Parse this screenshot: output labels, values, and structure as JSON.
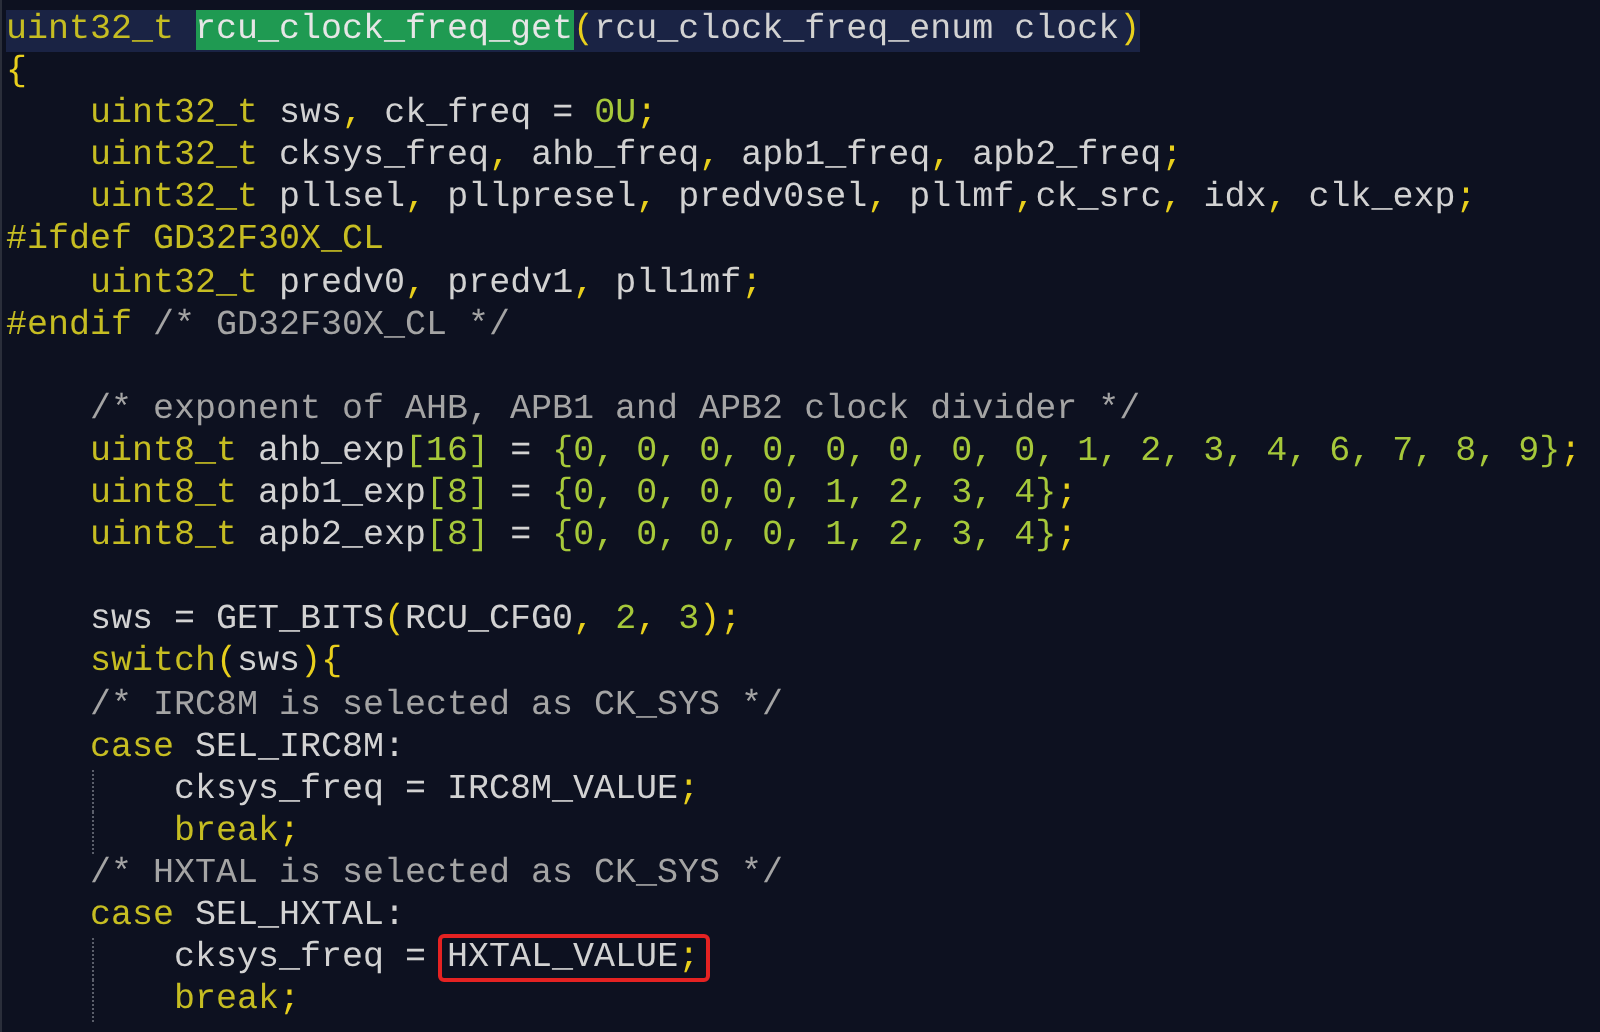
{
  "editor": {
    "lines": [
      {
        "current": true,
        "guide": false,
        "tokens": [
          {
            "kind": "type",
            "text": "uint32_t "
          },
          {
            "kind": "hl",
            "text": "rcu_clock_freq_get"
          },
          {
            "kind": "punct",
            "text": "("
          },
          {
            "kind": "plain",
            "text": "rcu_clock_freq_enum clock"
          },
          {
            "kind": "punct",
            "text": ")"
          }
        ]
      },
      {
        "current": false,
        "guide": false,
        "tokens": [
          {
            "kind": "punct",
            "text": "{"
          }
        ]
      },
      {
        "current": false,
        "guide": false,
        "tokens": [
          {
            "kind": "type",
            "text": "    uint32_t"
          },
          {
            "kind": "plain",
            "text": " sws"
          },
          {
            "kind": "punct",
            "text": ","
          },
          {
            "kind": "plain",
            "text": " ck_freq = "
          },
          {
            "kind": "num",
            "text": "0U"
          },
          {
            "kind": "punct",
            "text": ";"
          }
        ]
      },
      {
        "current": false,
        "guide": false,
        "tokens": [
          {
            "kind": "type",
            "text": "    uint32_t"
          },
          {
            "kind": "plain",
            "text": " cksys_freq"
          },
          {
            "kind": "punct",
            "text": ","
          },
          {
            "kind": "plain",
            "text": " ahb_freq"
          },
          {
            "kind": "punct",
            "text": ","
          },
          {
            "kind": "plain",
            "text": " apb1_freq"
          },
          {
            "kind": "punct",
            "text": ","
          },
          {
            "kind": "plain",
            "text": " apb2_freq"
          },
          {
            "kind": "punct",
            "text": ";"
          }
        ]
      },
      {
        "current": false,
        "guide": false,
        "tokens": [
          {
            "kind": "type",
            "text": "    uint32_t"
          },
          {
            "kind": "plain",
            "text": " pllsel"
          },
          {
            "kind": "punct",
            "text": ","
          },
          {
            "kind": "plain",
            "text": " pllpresel"
          },
          {
            "kind": "punct",
            "text": ","
          },
          {
            "kind": "plain",
            "text": " predv0sel"
          },
          {
            "kind": "punct",
            "text": ","
          },
          {
            "kind": "plain",
            "text": " pllmf"
          },
          {
            "kind": "punct",
            "text": ","
          },
          {
            "kind": "plain",
            "text": "ck_src"
          },
          {
            "kind": "punct",
            "text": ","
          },
          {
            "kind": "plain",
            "text": " idx"
          },
          {
            "kind": "punct",
            "text": ","
          },
          {
            "kind": "plain",
            "text": " clk_exp"
          },
          {
            "kind": "punct",
            "text": ";"
          }
        ]
      },
      {
        "current": false,
        "guide": false,
        "tokens": [
          {
            "kind": "pre",
            "text": "#ifdef GD32F30X_CL"
          }
        ]
      },
      {
        "current": false,
        "guide": false,
        "tokens": [
          {
            "kind": "type",
            "text": "    uint32_t"
          },
          {
            "kind": "plain",
            "text": " predv0"
          },
          {
            "kind": "punct",
            "text": ","
          },
          {
            "kind": "plain",
            "text": " predv1"
          },
          {
            "kind": "punct",
            "text": ","
          },
          {
            "kind": "plain",
            "text": " pll1mf"
          },
          {
            "kind": "punct",
            "text": ";"
          }
        ]
      },
      {
        "current": false,
        "guide": false,
        "tokens": [
          {
            "kind": "pre",
            "text": "#endif "
          },
          {
            "kind": "comment",
            "text": "/* GD32F30X_CL */"
          }
        ]
      },
      {
        "current": false,
        "guide": false
      },
      {
        "current": false,
        "guide": false,
        "tokens": [
          {
            "kind": "comment",
            "text": "    /* exponent of AHB, APB1 and APB2 clock divider */"
          }
        ]
      },
      {
        "current": false,
        "guide": false,
        "tokens": [
          {
            "kind": "type",
            "text": "    uint8_t"
          },
          {
            "kind": "plain",
            "text": " ahb_exp"
          },
          {
            "kind": "num",
            "text": "[16]"
          },
          {
            "kind": "plain",
            "text": " = "
          },
          {
            "kind": "num",
            "text": "{0, 0, 0, 0, 0, 0, 0, 0, 1, 2, 3, 4, 6, 7, 8, 9}"
          },
          {
            "kind": "punct",
            "text": ";"
          }
        ]
      },
      {
        "current": false,
        "guide": false,
        "tokens": [
          {
            "kind": "type",
            "text": "    uint8_t"
          },
          {
            "kind": "plain",
            "text": " apb1_exp"
          },
          {
            "kind": "num",
            "text": "[8]"
          },
          {
            "kind": "plain",
            "text": " = "
          },
          {
            "kind": "num",
            "text": "{0, 0, 0, 0, 1, 2, 3, 4}"
          },
          {
            "kind": "punct",
            "text": ";"
          }
        ]
      },
      {
        "current": false,
        "guide": false,
        "tokens": [
          {
            "kind": "type",
            "text": "    uint8_t"
          },
          {
            "kind": "plain",
            "text": " apb2_exp"
          },
          {
            "kind": "num",
            "text": "[8]"
          },
          {
            "kind": "plain",
            "text": " = "
          },
          {
            "kind": "num",
            "text": "{0, 0, 0, 0, 1, 2, 3, 4}"
          },
          {
            "kind": "punct",
            "text": ";"
          }
        ]
      },
      {
        "current": false,
        "guide": false
      },
      {
        "current": false,
        "guide": false,
        "tokens": [
          {
            "kind": "plain",
            "text": "    sws = GET_BITS"
          },
          {
            "kind": "punct",
            "text": "("
          },
          {
            "kind": "plain",
            "text": "RCU_CFG0"
          },
          {
            "kind": "punct",
            "text": ","
          },
          {
            "kind": "num",
            "text": " 2"
          },
          {
            "kind": "punct",
            "text": ","
          },
          {
            "kind": "num",
            "text": " 3"
          },
          {
            "kind": "punct",
            "text": ");"
          }
        ]
      },
      {
        "current": false,
        "guide": false,
        "tokens": [
          {
            "kind": "type",
            "text": "    switch"
          },
          {
            "kind": "punct",
            "text": "("
          },
          {
            "kind": "plain",
            "text": "sws"
          },
          {
            "kind": "punct",
            "text": "){"
          }
        ]
      },
      {
        "current": false,
        "guide": false,
        "tokens": [
          {
            "kind": "comment",
            "text": "    /* IRC8M is selected as CK_SYS */"
          }
        ]
      },
      {
        "current": false,
        "guide": false,
        "tokens": [
          {
            "kind": "type",
            "text": "    case"
          },
          {
            "kind": "plain",
            "text": " SEL_IRC8M:"
          }
        ]
      },
      {
        "current": false,
        "guide": true,
        "tokens": [
          {
            "kind": "plain",
            "text": "        cksys_freq = IRC8M_VALUE"
          },
          {
            "kind": "punct",
            "text": ";"
          }
        ]
      },
      {
        "current": false,
        "guide": true,
        "tokens": [
          {
            "kind": "type",
            "text": "        break"
          },
          {
            "kind": "punct",
            "text": ";"
          }
        ]
      },
      {
        "current": false,
        "guide": false,
        "tokens": [
          {
            "kind": "comment",
            "text": "    /* HXTAL is selected as CK_SYS */"
          }
        ]
      },
      {
        "current": false,
        "guide": false,
        "tokens": [
          {
            "kind": "type",
            "text": "    case"
          },
          {
            "kind": "plain",
            "text": " SEL_HXTAL:"
          }
        ]
      },
      {
        "current": false,
        "guide": true,
        "tokens": [
          {
            "kind": "plain",
            "text": "        cksys_freq = "
          },
          {
            "kind": "boxed",
            "parts": [
              {
                "kind": "plain",
                "text": "HXTAL_VALUE"
              },
              {
                "kind": "punct",
                "text": ";"
              }
            ]
          }
        ]
      },
      {
        "current": false,
        "guide": true,
        "tokens": [
          {
            "kind": "type",
            "text": "        break"
          },
          {
            "kind": "punct",
            "text": ";"
          }
        ]
      }
    ]
  }
}
